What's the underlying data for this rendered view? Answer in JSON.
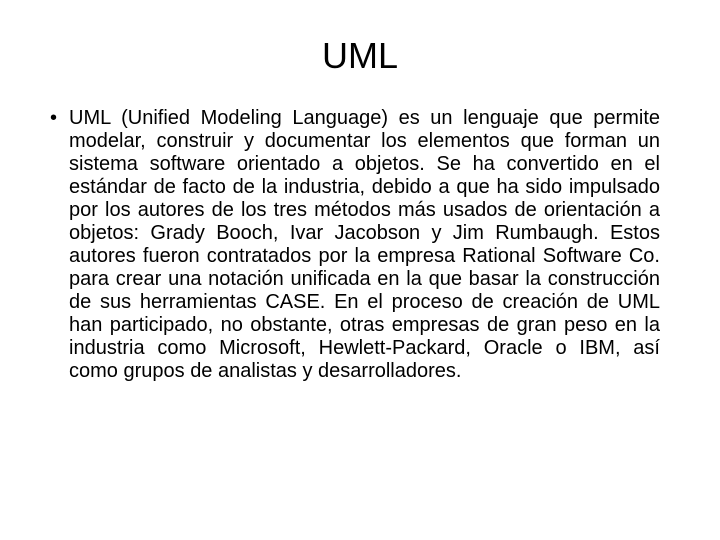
{
  "title": "UML",
  "bullet": "•",
  "body": "UML (Unified Modeling Language) es un lenguaje que permite modelar, construir y documentar los elementos que forman un sistema software orientado a objetos. Se ha convertido en el estándar de facto de la industria, debido a que ha sido impulsado por los autores de los tres métodos más usados de orientación a objetos: Grady Booch, Ivar Jacobson y Jim Rumbaugh. Estos autores fueron contratados por la empresa Rational Software Co. para crear una notación unificada en la que basar la construcción de sus herramientas CASE. En el proceso de creación de UML han participado, no obstante, otras empresas de gran peso en la industria como Microsoft, Hewlett-Packard, Oracle o IBM, así como grupos de analistas y desarrolladores."
}
